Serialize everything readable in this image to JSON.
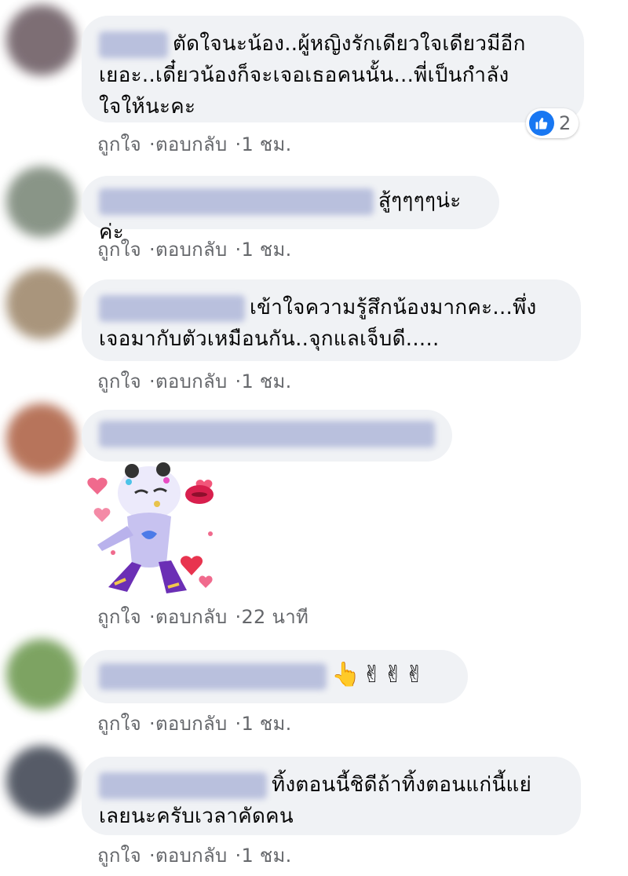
{
  "comments": [
    {
      "text": "ตัดใจนะน้อง..ผู้หญิงรักเดียวใจเดียวมีอีก เยอะ..เดี๋ยวน้องก็จะเจอเธอคนนั้น...พี่เป็นกำลัง ใจให้นะคะ",
      "line1": "ตัดใจนะน้อง..ผู้หญิงรักเดียวใจเดียวมีอีก",
      "line2": "เยอะ..เดี๋ยวน้องก็จะเจอเธอคนนั้น...พี่เป็นกำลัง",
      "line3": "ใจให้นะคะ",
      "like_label": "ถูกใจ",
      "reply_label": "ตอบกลับ",
      "time": "1 ชม.",
      "reaction_count": "2",
      "avatar_color": "#6f5f66"
    },
    {
      "text": "สู้ๆๆๆๆน่ะค่ะ",
      "like_label": "ถูกใจ",
      "reply_label": "ตอบกลับ",
      "time": "1 ชม.",
      "avatar_color": "#7d8a7b"
    },
    {
      "line1": "เข้าใจความรู้สึกน้องมากคะ...พึ่ง",
      "line2": "เจอมากับตัวเหมือนกัน..จุกแลเจ็บดี.....",
      "like_label": "ถูกใจ",
      "reply_label": "ตอบกลับ",
      "time": "1 ชม.",
      "avatar_color": "#a08a6e"
    },
    {
      "sticker_name": "kissing-sticker",
      "like_label": "ถูกใจ",
      "reply_label": "ตอบกลับ",
      "time": "22 นาที",
      "avatar_color": "#b0664a"
    },
    {
      "emojis": "👆✌✌✌",
      "like_label": "ถูกใจ",
      "reply_label": "ตอบกลับ",
      "time": "1 ชม.",
      "avatar_color": "#6f9a52"
    },
    {
      "line1": "ทิ้งตอนนี้ชิดีถ้าทิ้งตอนแก่นี้แย่",
      "line2": "เลยนะครับเวลาคัดคน",
      "like_label": "ถูกใจ",
      "reply_label": "ตอบกลับ",
      "time": "1 ชม.",
      "avatar_color": "#444a57"
    }
  ],
  "colors": {
    "bubble": "#f0f2f5",
    "meta_text": "#65676b",
    "like_blue": "#1877f2",
    "name_blur": "#b9c0dd"
  }
}
